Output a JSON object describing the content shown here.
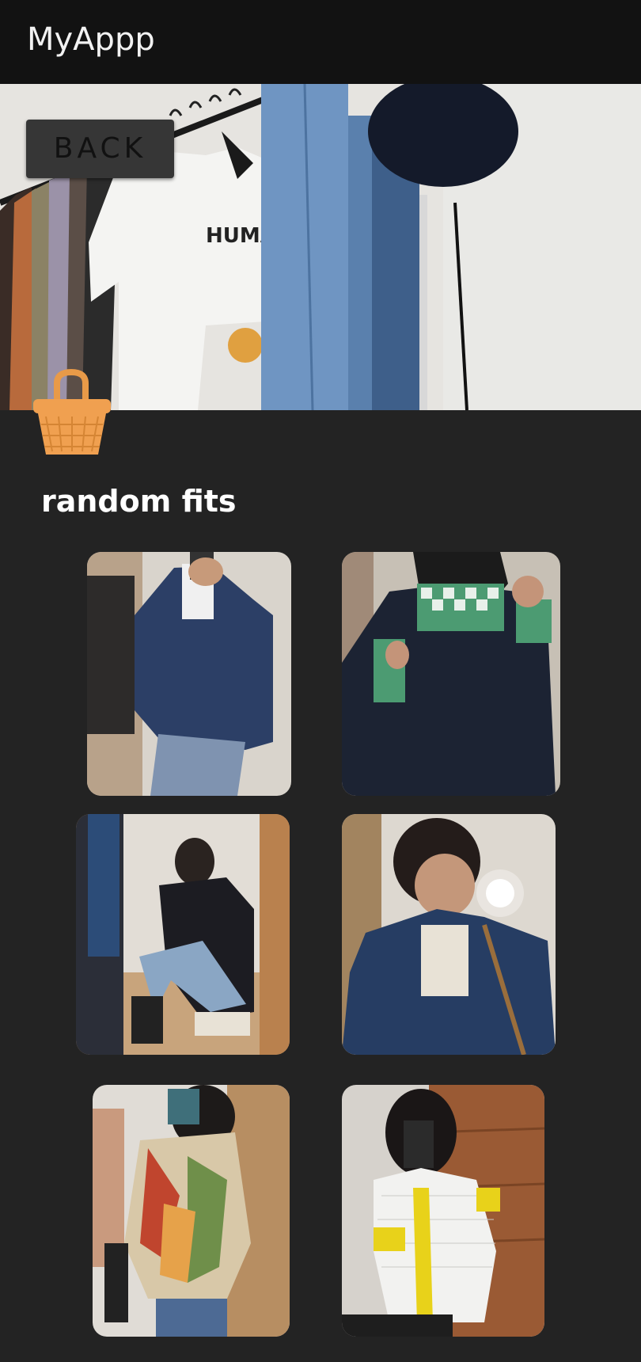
{
  "app_bar": {
    "title": "MyAppp"
  },
  "back_button": {
    "label": "BACK"
  },
  "hero": {
    "image": "clothing-rack-with-denim-and-tshirts"
  },
  "section": {
    "icon": "shopping-basket-icon",
    "title": "random fits"
  },
  "gallery": {
    "photos": [
      "outfit-photo-denim-jacket",
      "outfit-photo-black-puffer-green-check",
      "outfit-photo-black-sweater-sitting",
      "outfit-photo-denim-jacket-flash",
      "outfit-photo-printed-scarf-top",
      "outfit-photo-yellow-cardigan"
    ]
  },
  "colors": {
    "app_bar": "#121212",
    "background": "#232323",
    "button": "#363636",
    "basket": "#F0A050"
  }
}
